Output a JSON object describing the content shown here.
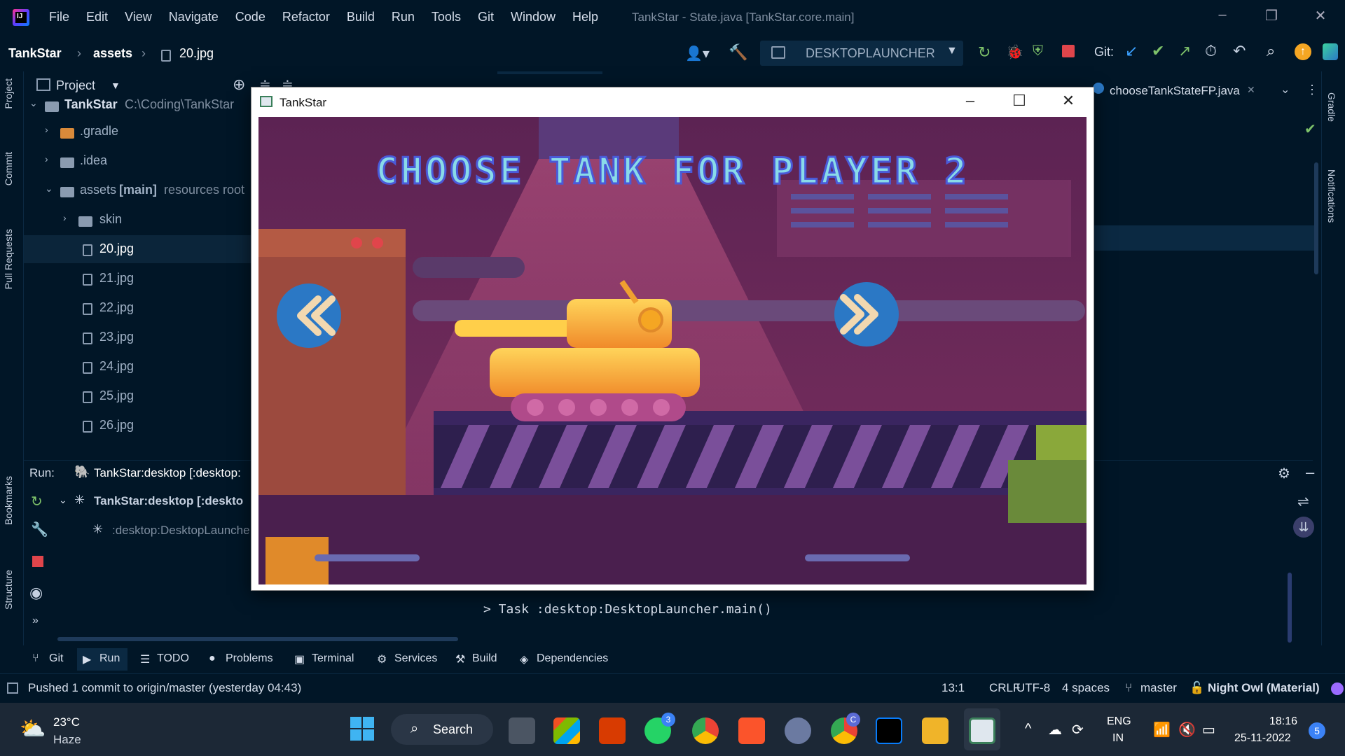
{
  "app": {
    "menu": [
      "File",
      "Edit",
      "View",
      "Navigate",
      "Code",
      "Refactor",
      "Build",
      "Run",
      "Tools",
      "Git",
      "Window",
      "Help"
    ],
    "window_title": "TankStar - State.java [TankStar.core.main]"
  },
  "breadcrumb": [
    "TankStar",
    "assets",
    "20.jpg"
  ],
  "toolbar": {
    "run_config": "DESKTOPLAUNCHER",
    "git_label": "Git:"
  },
  "side_tabs": {
    "left": [
      "Project",
      "Commit",
      "Pull Requests",
      "Bookmarks",
      "Structure"
    ],
    "right": [
      "Gradle",
      "Notifications"
    ]
  },
  "project_panel": {
    "title": "Project",
    "tree": [
      {
        "label": "TankStar",
        "note": "C:\\Coding\\TankStar",
        "type": "project",
        "depth": 0
      },
      {
        "label": ".gradle",
        "type": "folder-orange",
        "depth": 1
      },
      {
        "label": ".idea",
        "type": "folder",
        "depth": 1
      },
      {
        "label": "assets",
        "bold_note": "[main]",
        "note": "resources root",
        "type": "folder",
        "depth": 1
      },
      {
        "label": "skin",
        "type": "folder",
        "depth": 2
      },
      {
        "label": "20.jpg",
        "type": "file",
        "depth": 2,
        "selected": true
      },
      {
        "label": "21.jpg",
        "type": "file",
        "depth": 2
      },
      {
        "label": "22.jpg",
        "type": "file",
        "depth": 2
      },
      {
        "label": "23.jpg",
        "type": "file",
        "depth": 2
      },
      {
        "label": "24.jpg",
        "type": "file",
        "depth": 2
      },
      {
        "label": "25.jpg",
        "type": "file",
        "depth": 2
      },
      {
        "label": "26.jpg",
        "type": "file",
        "depth": 2
      }
    ]
  },
  "editor": {
    "tab_label": "chooseTankStateFP.java"
  },
  "run_panel": {
    "label": "Run:",
    "tab": "TankStar:desktop [:desktop:",
    "tree_root": "TankStar:desktop [:deskto",
    "tree_child": ":desktop:DesktopLaunche",
    "console_line": "> Task :desktop:DesktopLauncher.main()"
  },
  "bottom_tabs": [
    "Git",
    "Run",
    "TODO",
    "Problems",
    "Terminal",
    "Services",
    "Build",
    "Dependencies"
  ],
  "status_bar": {
    "message": "Pushed 1 commit to origin/master (yesterday 04:43)",
    "position": "13:1",
    "line_sep": "CRLF",
    "encoding": "UTF-8",
    "indent": "4 spaces",
    "branch": "master",
    "theme": "Night Owl (Material)"
  },
  "game_window": {
    "title": "TankStar",
    "heading": "CHOOSE TANK FOR PLAYER 2"
  },
  "taskbar": {
    "weather_temp": "23°C",
    "weather_desc": "Haze",
    "search_label": "Search",
    "lang_top": "ENG",
    "lang_bottom": "IN",
    "time": "18:16",
    "date": "25-11-2022",
    "whatsapp_badge": "3",
    "notif_count": "5",
    "chrome_profile": "C"
  },
  "colors": {
    "ide_bg": "#011627",
    "game_bg": "#6b2a5e",
    "arrow_button": "#2b78c5",
    "tank": "#f7b33b"
  }
}
